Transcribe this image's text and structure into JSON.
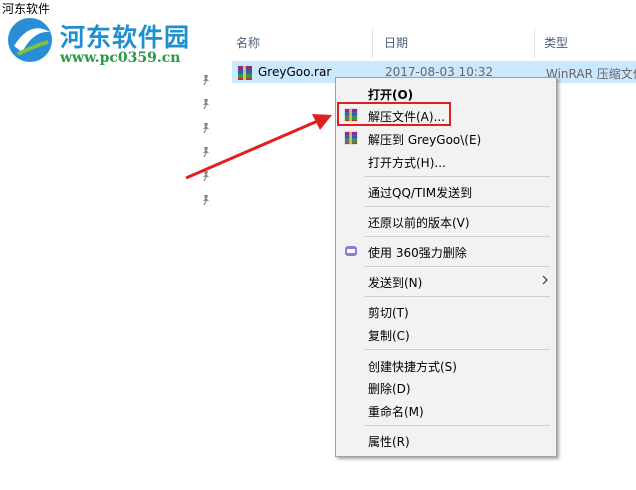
{
  "window": {
    "title": "河东软件"
  },
  "watermark": {
    "brand": "河东软件园",
    "url": "www.pc0359.cn"
  },
  "columns": {
    "name": "名称",
    "date": "日期",
    "type": "类型"
  },
  "file": {
    "name": "GreyGoo.rar",
    "date": "2017-08-03 10:32",
    "type": "WinRAR 压缩文件"
  },
  "menu": {
    "open": "打开(O)",
    "extract_files": "解压文件(A)...",
    "extract_to": "解压到 GreyGoo\\(E)",
    "open_with": "打开方式(H)...",
    "send_qq": "通过QQ/TIM发送到",
    "restore": "还原以前的版本(V)",
    "delete_360": "使用 360强力删除",
    "send_to": "发送到(N)",
    "cut": "剪切(T)",
    "copy": "复制(C)",
    "create_shortcut": "创建快捷方式(S)",
    "delete": "删除(D)",
    "rename": "重命名(M)",
    "properties": "属性(R)"
  },
  "icons": {
    "rar": "winrar-icon",
    "pin": "pin-icon",
    "shield": "360-icon",
    "submenu": "chevron-right-icon"
  },
  "colors": {
    "selection": "#cce8ff",
    "highlight": "#e02020",
    "menu_bg": "#f2f2f2"
  }
}
